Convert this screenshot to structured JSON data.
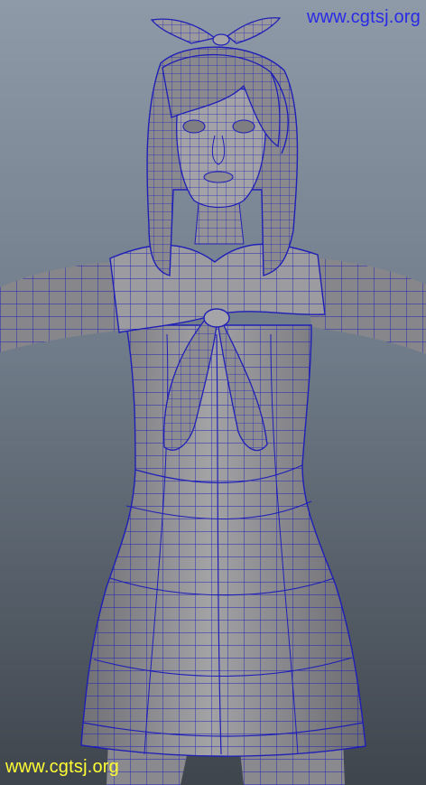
{
  "watermarks": {
    "top_right": "www.cgtsj.org",
    "bottom_left": "www.cgtsj.org"
  },
  "scene": {
    "subject": "wireframe-character-model",
    "wire_color": "#1f1fb8",
    "mesh_fill": "#8b8b8e",
    "background_top": "#8e9aa8",
    "background_bottom": "#3f454d"
  }
}
